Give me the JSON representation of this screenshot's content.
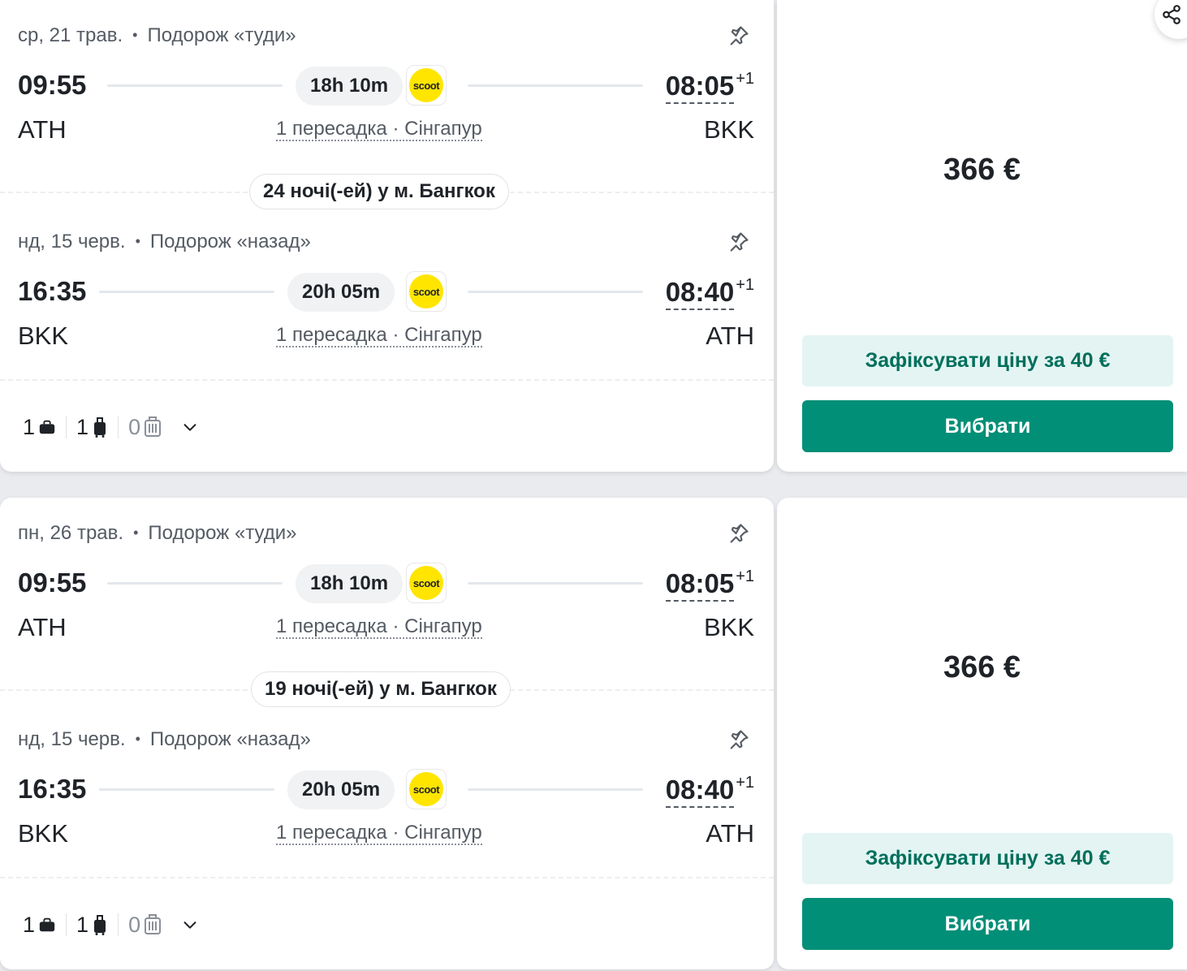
{
  "share_icon": "share-icon",
  "results": [
    {
      "outbound": {
        "date": "ср, 21 трав.",
        "label": "Подорож «туди»",
        "dep_time": "09:55",
        "arr_time": "08:05",
        "day_offset": "+1",
        "duration": "18h 10m",
        "airline_logo": "scoot",
        "from": "ATH",
        "to": "BKK",
        "stops": "1 пересадка · Сінгапур"
      },
      "nights": "24 ночі(-ей) у м. Бангкок",
      "inbound": {
        "date": "нд, 15 черв.",
        "label": "Подорож «назад»",
        "dep_time": "16:35",
        "arr_time": "08:40",
        "day_offset": "+1",
        "duration": "20h 05m",
        "airline_logo": "scoot",
        "from": "BKK",
        "to": "ATH",
        "stops": "1 пересадка · Сінгапур"
      },
      "bags": {
        "personal": "1",
        "cabin": "1",
        "checked": "0"
      },
      "price": "366 €",
      "lock_label": "Зафіксувати ціну за 40 €",
      "select_label": "Вибрати"
    },
    {
      "outbound": {
        "date": "пн, 26 трав.",
        "label": "Подорож «туди»",
        "dep_time": "09:55",
        "arr_time": "08:05",
        "day_offset": "+1",
        "duration": "18h 10m",
        "airline_logo": "scoot",
        "from": "ATH",
        "to": "BKK",
        "stops": "1 пересадка · Сінгапур"
      },
      "nights": "19 ночі(-ей) у м. Бангкок",
      "inbound": {
        "date": "нд, 15 черв.",
        "label": "Подорож «назад»",
        "dep_time": "16:35",
        "arr_time": "08:40",
        "day_offset": "+1",
        "duration": "20h 05m",
        "airline_logo": "scoot",
        "from": "BKK",
        "to": "ATH",
        "stops": "1 пересадка · Сінгапур"
      },
      "bags": {
        "personal": "1",
        "cabin": "1",
        "checked": "0"
      },
      "price": "366 €",
      "lock_label": "Зафіксувати ціну за 40 €",
      "select_label": "Вибрати"
    }
  ],
  "colors": {
    "primary": "#018f77",
    "lock_bg": "#e3f4f3",
    "lock_text": "#006f5b",
    "scoot_yellow": "#ffe500"
  }
}
